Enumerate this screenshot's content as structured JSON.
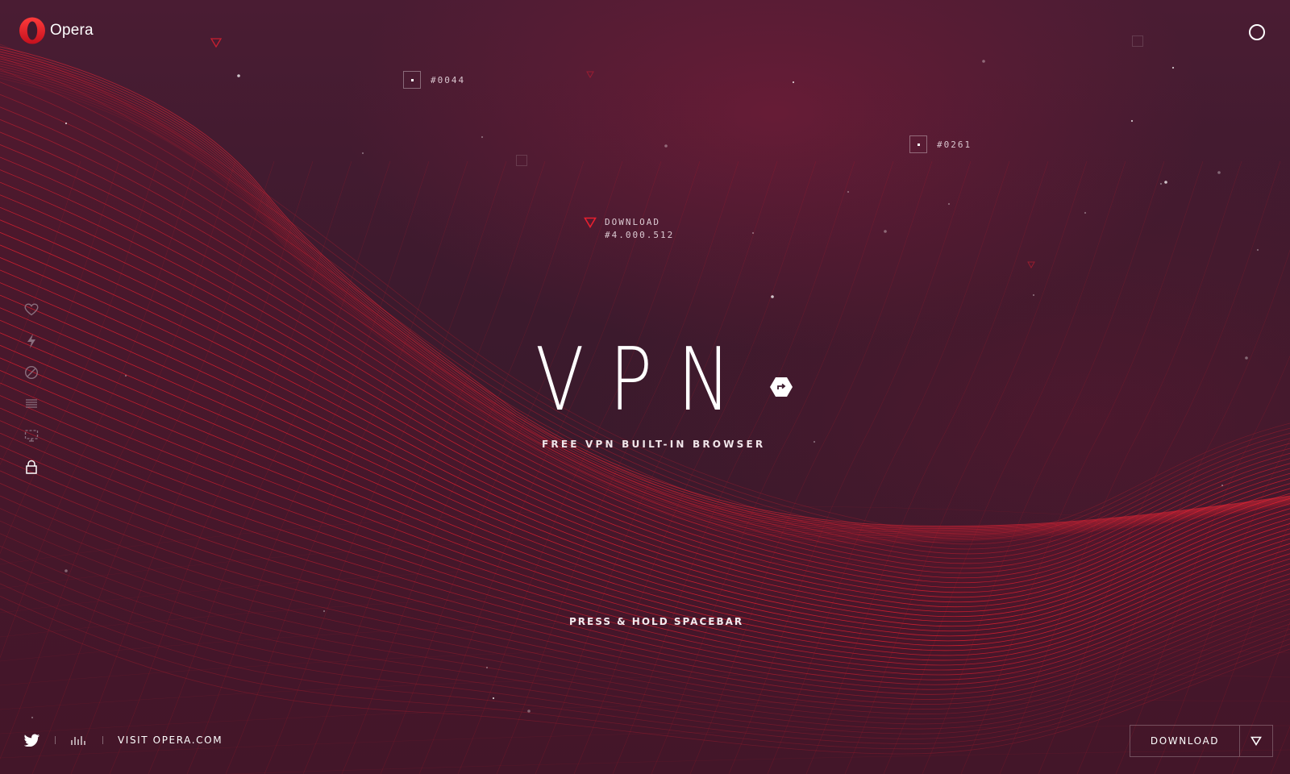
{
  "brand": {
    "logo_text": "Opera",
    "accent_color": "#e8202f",
    "background_color": "#3c1a2d"
  },
  "header": {
    "menu_icon": "circle-menu-icon"
  },
  "markers": [
    {
      "label": "#0044"
    },
    {
      "label": "#0261"
    }
  ],
  "download_counter": {
    "label": "DOWNLOAD",
    "count": "#4.000.512"
  },
  "hero": {
    "title": "VPN",
    "subtitle": "FREE VPN BUILT-IN BROWSER",
    "badge_icon": "share-arrow-icon",
    "hint": "PRESS & HOLD SPACEBAR"
  },
  "side_nav": [
    {
      "icon": "heart-icon",
      "active": false
    },
    {
      "icon": "lightning-icon",
      "active": false
    },
    {
      "icon": "block-icon",
      "active": false
    },
    {
      "icon": "list-icon",
      "active": false
    },
    {
      "icon": "screen-icon",
      "active": false
    },
    {
      "icon": "lock-icon",
      "active": true
    }
  ],
  "footer": {
    "twitter_icon": "twitter-icon",
    "sound_icon": "sound-bars-icon",
    "visit_label": "VISIT OPERA.COM",
    "download_label": "DOWNLOAD",
    "download_icon": "download-triangle-icon"
  }
}
